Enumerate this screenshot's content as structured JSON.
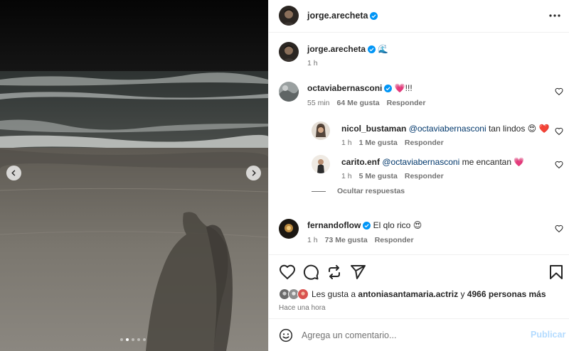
{
  "media": {
    "carousel_count": 5,
    "active_index": 1
  },
  "header": {
    "username": "jorge.arecheta",
    "verified": true,
    "more_icon": "more-horizontal-icon"
  },
  "caption": {
    "username": "jorge.arecheta",
    "text": "🌊",
    "time": "1 h"
  },
  "comments": [
    {
      "username": "octaviabernasconi",
      "verified": true,
      "text": "💗!!!",
      "time": "55 min",
      "likes": "64 Me gusta",
      "reply_label": "Responder"
    },
    {
      "username": "nicol_bustaman",
      "verified": false,
      "mention": "@octaviabernasconi",
      "text": "tan lindos 😍 ❤️",
      "time": "1 h",
      "likes": "1 Me gusta",
      "reply_label": "Responder"
    },
    {
      "username": "carito.enf",
      "verified": false,
      "mention": "@octaviabernasconi",
      "text": "me encantan 💗",
      "time": "1 h",
      "likes": "5 Me gusta",
      "reply_label": "Responder"
    },
    {
      "username": "fernandoflow",
      "verified": true,
      "text": "El qlo rico 😍",
      "time": "1 h",
      "likes": "73 Me gusta",
      "reply_label": "Responder"
    }
  ],
  "hide_replies_label": "Ocultar respuestas",
  "likes_summary": {
    "prefix": "Les gusta a",
    "user": "antoniasantamaria.actriz",
    "joiner": "y",
    "others": "4966 personas más"
  },
  "time_ago": "Hace una hora",
  "composer": {
    "placeholder": "Agrega un comentario...",
    "publish_label": "Publicar"
  },
  "colors": {
    "verified": "#0095f6",
    "publish_disabled": "#b3dbff",
    "mention": "#00376b",
    "meta": "#737373"
  }
}
